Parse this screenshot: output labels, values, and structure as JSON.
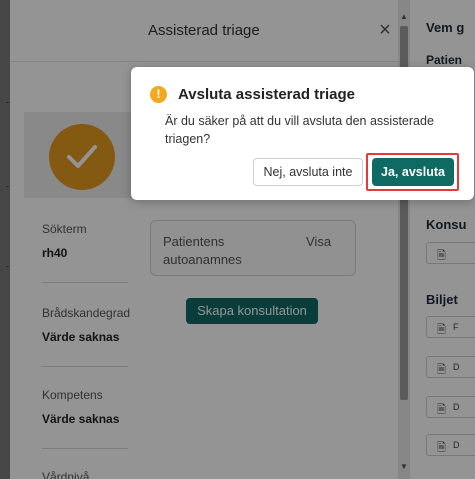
{
  "panel": {
    "title": "Assisterad triage",
    "close_glyph": "×",
    "sidebar": [
      {
        "label": "Sökterm",
        "value": "rh40"
      },
      {
        "label": "Brådskandegrad",
        "value": "Värde saknas"
      },
      {
        "label": "Kompetens",
        "value": "Värde saknas"
      },
      {
        "label": "Vårdnivå",
        "value": ""
      }
    ],
    "patient_card": {
      "line1": "Patientens",
      "line2": "autoanamnes",
      "action": "Visa"
    },
    "create_button": "Skapa konsultation"
  },
  "background_page": {
    "title": "Vem g",
    "subtitle": "Patien",
    "section_consult": "Konsu",
    "section_tickets": "Biljet",
    "ticket_items": [
      "F",
      "D",
      "D",
      "D"
    ]
  },
  "modal": {
    "title": "Avsluta assisterad triage",
    "body": "Är du säker på att du vill avsluta den assisterade triagen?",
    "cancel_label": "Nej, avsluta inte",
    "confirm_label": "Ja, avsluta",
    "icon": "warning-icon",
    "accent_color": "#0f6a64",
    "warning_color": "#f2a91f"
  }
}
